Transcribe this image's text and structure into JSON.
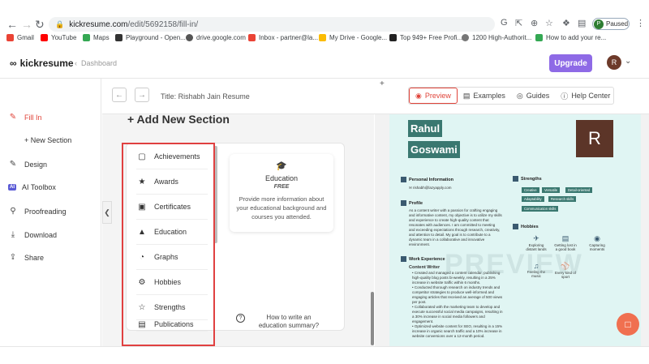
{
  "browser": {
    "url_host": "kickresume.com",
    "url_path": "/edit/5692158/fill-in/",
    "profile_label": "Paused",
    "profile_initial": "P",
    "bookmarks": [
      {
        "label": "Gmail",
        "color": "#ea4335"
      },
      {
        "label": "YouTube",
        "color": "#ff0000"
      },
      {
        "label": "Maps",
        "color": "#34a853"
      },
      {
        "label": "Playground - Open...",
        "color": "#333333"
      },
      {
        "label": "drive.google.com",
        "color": "#555555"
      },
      {
        "label": "Inbox - partner@la...",
        "color": "#ea4335"
      },
      {
        "label": "My Drive - Google...",
        "color": "#fbbc04"
      },
      {
        "label": "Top 949+ Free Profi...",
        "color": "#222222"
      },
      {
        "label": "1200 High-Authorit...",
        "color": "#777777"
      },
      {
        "label": "How to add your re...",
        "color": "#34a853"
      }
    ]
  },
  "app": {
    "logo": "kickresume",
    "breadcrumb": "Dashboard",
    "upgrade_label": "Upgrade",
    "user_initial": "R",
    "accent": "#e0443a",
    "upgrade_color": "#8e6ae6"
  },
  "sidebar": {
    "items": [
      {
        "label": "Fill In",
        "icon": "edit-icon"
      },
      {
        "label": "+ New Section",
        "icon": ""
      },
      {
        "label": "Design",
        "icon": "design-icon"
      },
      {
        "label": "AI Toolbox",
        "icon": "ai-icon",
        "badge": "AI"
      },
      {
        "label": "Proofreading",
        "icon": "proofread-icon"
      },
      {
        "label": "Download",
        "icon": "download-icon"
      },
      {
        "label": "Share",
        "icon": "share-icon"
      }
    ]
  },
  "toolbar": {
    "title": "Title: Rishabh Jain Resume",
    "tabs": [
      {
        "label": "Preview",
        "icon": "eye-icon"
      },
      {
        "label": "Examples",
        "icon": "book-icon"
      },
      {
        "label": "Guides",
        "icon": "guide-icon"
      },
      {
        "label": "Help Center",
        "icon": "help-icon"
      }
    ]
  },
  "editor": {
    "heading": "+ Add New Section",
    "sections": [
      {
        "label": "Achievements",
        "icon": "badge-icon"
      },
      {
        "label": "Awards",
        "icon": "trophy-icon"
      },
      {
        "label": "Certificates",
        "icon": "certificate-icon"
      },
      {
        "label": "Education",
        "icon": "graduation-icon"
      },
      {
        "label": "Graphs",
        "icon": "graph-icon"
      },
      {
        "label": "Hobbies",
        "icon": "hobbies-icon"
      },
      {
        "label": "Strengths",
        "icon": "star-icon"
      },
      {
        "label": "Publications",
        "icon": "publication-icon"
      }
    ],
    "card": {
      "title": "Education",
      "tag": "FREE",
      "description": "Provide more information about your educational background and courses you attended."
    },
    "howto": "How to write an education summary?"
  },
  "resume": {
    "first_name": "Rahul",
    "last_name": "Goswami",
    "initial": "R",
    "watermark": "PREVIEW",
    "personal_title": "Personal Information",
    "email": "rishabh@lazyapply.com",
    "profile_title": "Profile",
    "profile_text": "As a content writer with a passion for crafting engaging and informative content, my objective is to utilize my skills and experience to create high-quality content that resonates with audiences. I am committed to meeting and exceeding expectations through research, creativity, and attention to detail. My goal is to contribute to a dynamic team in a collaborative and innovative environment.",
    "work_title": "Work Experience",
    "job_title": "Content Writer",
    "bullets": [
      "Created and managed a content calendar, publishing high-quality blog posts bi-weekly, resulting in a 25% increase in website traffic within 6 months.",
      "Conducted thorough research on industry trends and competitor strategies to produce well-informed and engaging articles that received an average of 500 views per post.",
      "Collaborated with the marketing team to develop and execute successful social media campaigns, resulting in a 30% increase in social media followers and engagement.",
      "Optimized website content for SEO, resulting in a 15% increase in organic search traffic and a 10% increase in website conversions over a 12-month period."
    ],
    "strengths_title": "Strengths",
    "strengths": [
      "Creative",
      "Versatile",
      "Detail-oriented",
      "Adaptability",
      "Research skills",
      "Communication skills"
    ],
    "hobbies_title": "Hobbies",
    "hobbies": [
      {
        "label": "Exploring distant lands",
        "icon": "plane-icon"
      },
      {
        "label": "Getting lost in a good book",
        "icon": "book-icon"
      },
      {
        "label": "Capturing moments",
        "icon": "camera-icon"
      },
      {
        "label": "Feeling the music",
        "icon": "music-icon"
      },
      {
        "label": "Every kind of sport",
        "icon": "sport-icon"
      }
    ]
  }
}
